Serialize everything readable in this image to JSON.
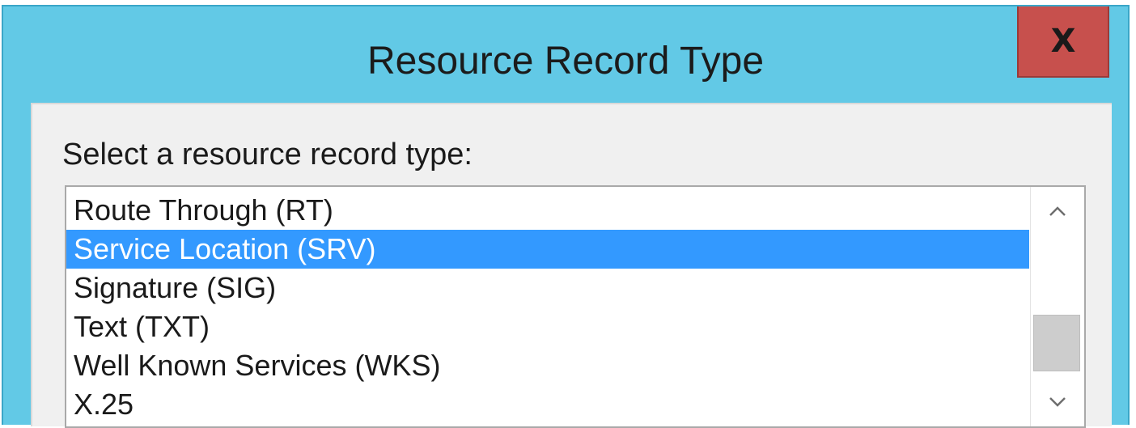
{
  "dialog": {
    "title": "Resource Record Type",
    "close_label": "X",
    "prompt": "Select a resource record type:",
    "record_types": [
      {
        "label": "Route Through (RT)"
      },
      {
        "label": "Service Location (SRV)"
      },
      {
        "label": "Signature (SIG)"
      },
      {
        "label": "Text (TXT)"
      },
      {
        "label": "Well Known Services (WKS)"
      },
      {
        "label": "X.25"
      }
    ],
    "selected_item": "Service Location (SRV)",
    "scrollbar": {
      "up_icon": "chevron-up-icon",
      "down_icon": "chevron-down-icon"
    }
  },
  "colors": {
    "titlebar": "#62c9e6",
    "close_button": "#c7504d",
    "selection": "#3399ff",
    "client_background": "#f0f0f0"
  }
}
